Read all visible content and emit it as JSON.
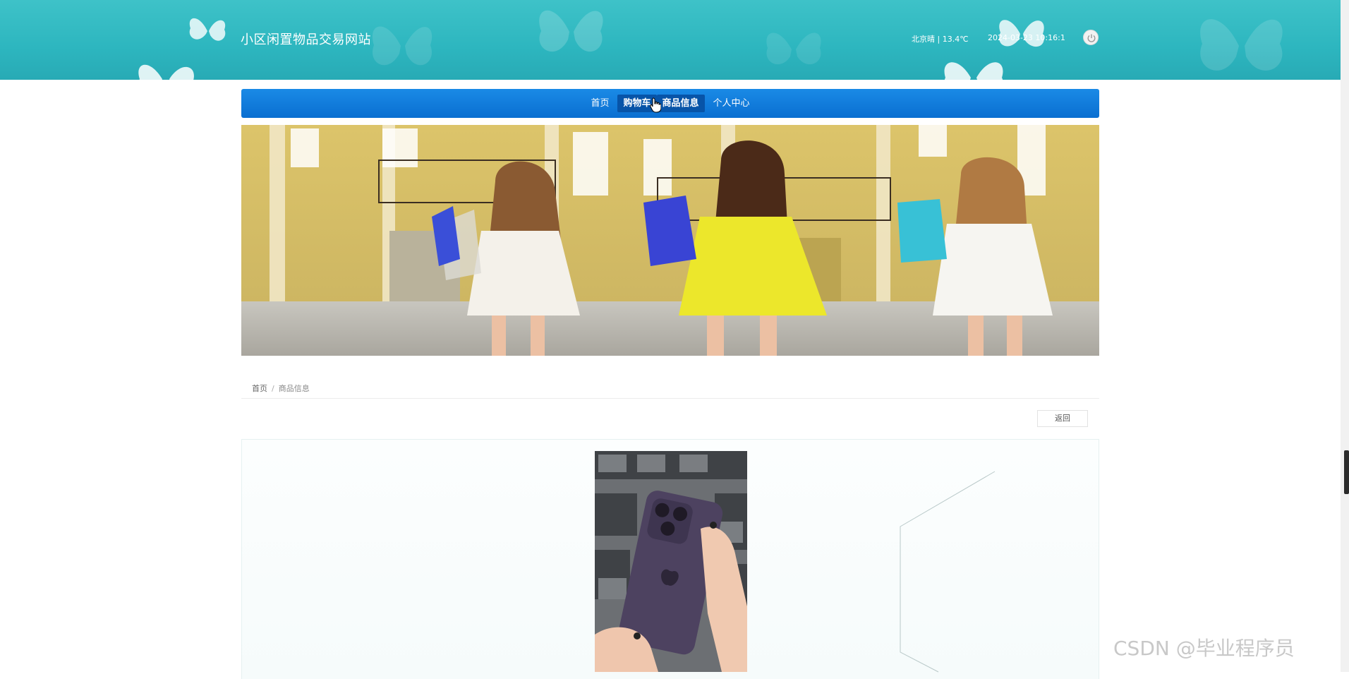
{
  "header": {
    "site_title": "小区闲置物品交易网站",
    "weather": "北京晴 | 13.4℃",
    "datetime": "2024-03-23  10:16:1",
    "power_icon": "power-icon"
  },
  "nav": {
    "items": [
      {
        "label": "首页"
      },
      {
        "label": "购物车"
      },
      {
        "label": "商品信息"
      },
      {
        "label": "个人中心"
      }
    ],
    "active_index": 2
  },
  "breadcrumb": {
    "home": "首页",
    "separator": "/",
    "current": "商品信息"
  },
  "actions": {
    "back_label": "返回"
  },
  "watermark": "CSDN @毕业程序员",
  "colors": {
    "header_bg": "#2db6bf",
    "nav_bg": "#0a6fd1",
    "nav_active": "#0754a8"
  }
}
